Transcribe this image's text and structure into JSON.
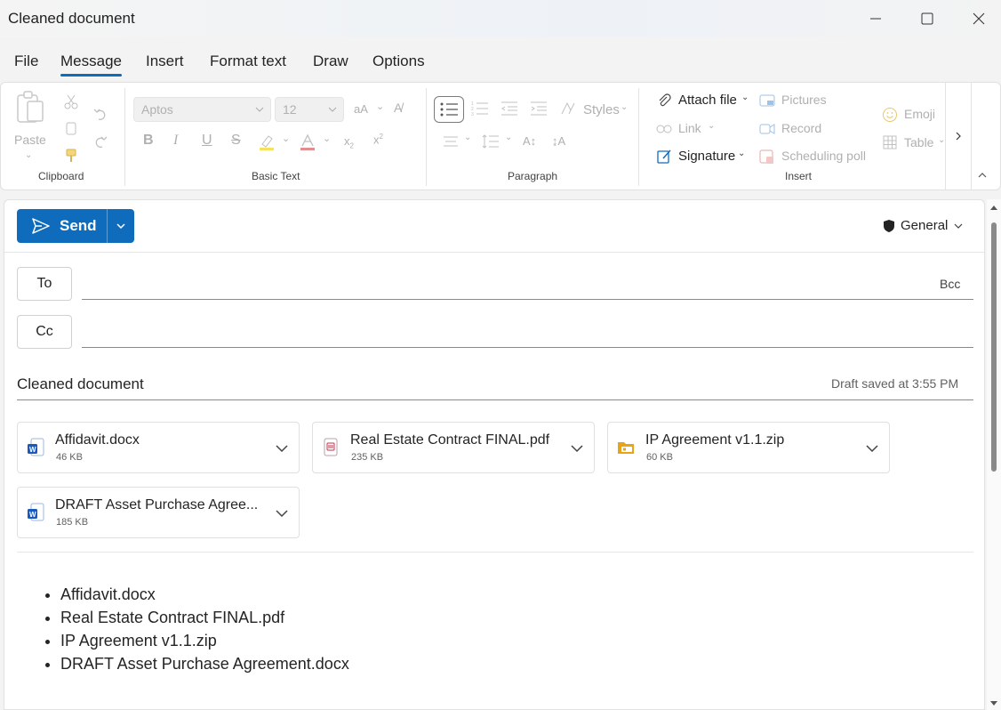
{
  "window": {
    "title": "Cleaned document"
  },
  "menu": {
    "items": [
      {
        "label": "File",
        "active": false
      },
      {
        "label": "Message",
        "active": true
      },
      {
        "label": "Insert",
        "active": false
      },
      {
        "label": "Format text",
        "active": false
      },
      {
        "label": "Draw",
        "active": false
      },
      {
        "label": "Options",
        "active": false
      }
    ]
  },
  "ribbon": {
    "clipboard": {
      "label": "Clipboard",
      "paste_label": "Paste"
    },
    "basic_text": {
      "label": "Basic Text",
      "font": "Aptos",
      "size": "12"
    },
    "paragraph": {
      "label": "Paragraph",
      "styles_label": "Styles"
    },
    "insert": {
      "label": "Insert",
      "attach_file": "Attach file",
      "link": "Link",
      "signature": "Signature",
      "pictures": "Pictures",
      "record": "Record",
      "scheduling_poll": "Scheduling poll",
      "emoji": "Emoji",
      "table": "Table"
    }
  },
  "compose": {
    "send_label": "Send",
    "sensitivity": "General",
    "to_label": "To",
    "cc_label": "Cc",
    "bcc_label": "Bcc",
    "subject": "Cleaned document",
    "draft_status": "Draft saved at 3:55 PM",
    "attachments": [
      {
        "name": "Affidavit.docx",
        "size": "46 KB",
        "type": "word"
      },
      {
        "name": "Real Estate Contract FINAL.pdf",
        "size": "235 KB",
        "type": "pdf"
      },
      {
        "name": "IP Agreement v1.1.zip",
        "size": "60 KB",
        "type": "zip"
      },
      {
        "name": "DRAFT Asset Purchase Agree...",
        "size": "185 KB",
        "type": "word"
      }
    ],
    "body_list": [
      "Affidavit.docx",
      "Real Estate Contract FINAL.pdf",
      "IP Agreement v1.1.zip",
      "DRAFT Asset Purchase Agreement.docx"
    ]
  },
  "colors": {
    "accent": "#0f6cbd",
    "word": "#185abd",
    "pdf": "#c4314b",
    "zip": "#e8a317"
  }
}
